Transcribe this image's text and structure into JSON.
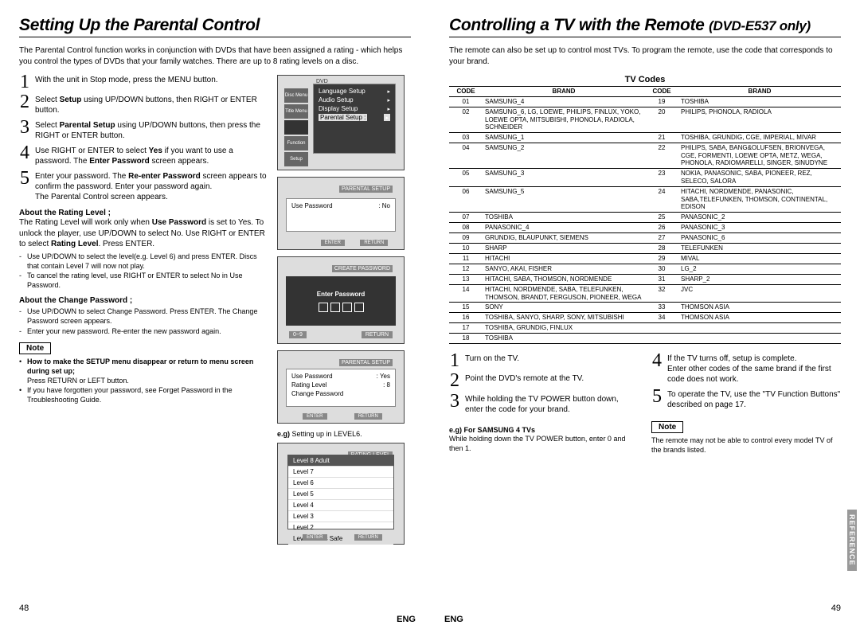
{
  "left": {
    "title": "Setting Up the Parental Control",
    "intro": "The Parental Control function works in conjunction with DVDs that have been assigned a rating - which helps you control the types of DVDs that your family watches. There are up to 8 rating levels on a disc.",
    "steps": [
      "With the unit in Stop mode, press the MENU button.",
      "Select <b>Setup</b> using UP/DOWN buttons, then RIGHT or ENTER button.",
      "Select <b>Parental Setup</b> using UP/DOWN buttons, then press the RIGHT or ENTER button.",
      "Use RIGHT or ENTER to select <b>Yes</b> if you want to use a password. The <b>Enter Password</b> screen appears.",
      "Enter your password. The <b>Re-enter Password</b> screen appears to confirm the password. Enter your password again.<br>The Parental Control screen appears."
    ],
    "about_rating_h": "About the Rating Level ;",
    "about_rating_b": "The Rating Level will work only when <b>Use Password</b> is set to Yes. To unlock the player, use UP/DOWN to select No. Use RIGHT or ENTER to select <b>Rating Level</b>. Press ENTER.",
    "about_rating_bullets": [
      "Use UP/DOWN to select the level(e.g. Level 6) and press ENTER. Discs that contain Level 7 will now not play.",
      "To cancel the rating level, use RIGHT or ENTER to select No in Use Password."
    ],
    "about_pw_h": "About the Change Password ;",
    "about_pw_bullets": [
      "Use UP/DOWN to select Change Password. Press ENTER. The Change Password screen appears.",
      "Enter your new password. Re-enter the new password again."
    ],
    "note_label": "Note",
    "note_b1": "How to make the SETUP menu disappear or return to menu screen during set up;",
    "note_b1s": "Press RETURN or LEFT button.",
    "note_b2": "If you have forgotten your password, see Forget Password in the Troubleshooting Guide.",
    "shot1": {
      "label": "DVD",
      "menu": [
        "Language Setup",
        "Audio Setup",
        "Display Setup"
      ],
      "hl": "Parental Setup :",
      "side": [
        "Disc Menu",
        "Title Menu",
        "",
        "Function",
        "Setup"
      ]
    },
    "shot2": {
      "title": "PARENTAL SETUP",
      "row_l": "Use Password",
      "row_r": ": No",
      "btns": [
        "ENTER",
        "RETURN"
      ]
    },
    "shot3": {
      "title": "CREATE PASSWORD",
      "label": "Enter Password",
      "range": "0~9",
      "btn": "RETURN"
    },
    "shot4": {
      "title": "PARENTAL SETUP",
      "rows": [
        [
          "Use Password",
          ": Yes"
        ],
        [
          "Rating Level",
          ": 8"
        ],
        [
          "Change Password",
          ""
        ]
      ],
      "btns": [
        "ENTER",
        "RETURN"
      ]
    },
    "eg_text": "e.g) Setting up in LEVEL6.",
    "shot5": {
      "title": "RATING LEVEL",
      "levels": [
        "Level 8 Adult",
        "Level 7",
        "Level 6",
        "Level 5",
        "Level 4",
        "Level 3",
        "Level 2",
        "Level 1 Kids Safe"
      ],
      "btns": [
        "ENTER",
        "RETURN"
      ]
    },
    "pagenum": "48",
    "eng": "ENG"
  },
  "right": {
    "title_a": "Controlling a TV with the Remote ",
    "title_b": "(DVD-E537 only)",
    "intro": "The remote can also be set up to control most TVs. To program the remote, use the code that corresponds to your brand.",
    "tvcodes_title": "TV Codes",
    "th_code": "CODE",
    "th_brand": "BRAND",
    "rows_l": [
      [
        "01",
        "SAMSUNG_4"
      ],
      [
        "02",
        "SAMSUNG_6, LG, LOEWE, PHILIPS, FINLUX, YOKO, LOEWE OPTA, MITSUBISHI, PHONOLA, RADIOLA, SCHNEIDER"
      ],
      [
        "03",
        "SAMSUNG_1"
      ],
      [
        "04",
        "SAMSUNG_2"
      ],
      [
        "05",
        "SAMSUNG_3"
      ],
      [
        "06",
        "SAMSUNG_5"
      ],
      [
        "07",
        "TOSHIBA"
      ],
      [
        "08",
        "PANASONIC_4"
      ],
      [
        "09",
        "GRUNDIG, BLAUPUNKT, SIEMENS"
      ],
      [
        "10",
        "SHARP"
      ],
      [
        "11",
        "HITACHI"
      ],
      [
        "12",
        "SANYO, AKAI, FISHER"
      ],
      [
        "13",
        "HITACHI, SABA, THOMSON, NORDMENDE"
      ],
      [
        "14",
        "HITACHI, NORDMENDE, SABA, TELEFUNKEN, THOMSON, BRANDT, FERGUSON, PIONEER, WEGA"
      ],
      [
        "15",
        "SONY"
      ],
      [
        "16",
        "TOSHIBA, SANYO, SHARP, SONY, MITSUBISHI"
      ],
      [
        "17",
        "TOSHIBA, GRUNDIG, FINLUX"
      ],
      [
        "18",
        "TOSHIBA"
      ]
    ],
    "rows_r": [
      [
        "19",
        "TOSHIBA"
      ],
      [
        "20",
        "PHILIPS, PHONOLA, RADIOLA"
      ],
      [
        "21",
        "TOSHIBA, GRUNDIG, CGE, IMPERIAL, MIVAR"
      ],
      [
        "22",
        "PHILIPS, SABA, BANG&OLUFSEN, BRIONVEGA, CGE, FORMENTI, LOEWE OPTA, METZ, WEGA, PHONOLA, RADIOMARELLI, SINGER, SINUDYNE"
      ],
      [
        "23",
        "NOKIA, PANASONIC, SABA, PIONEER, REZ, SELECO, SALORA"
      ],
      [
        "24",
        "HITACHI, NORDMENDE, PANASONIC, SABA,TELEFUNKEN, THOMSON, CONTINENTAL, EDISON"
      ],
      [
        "25",
        "PANASONIC_2"
      ],
      [
        "26",
        "PANASONIC_3"
      ],
      [
        "27",
        "PANASONIC_6"
      ],
      [
        "28",
        "TELEFUNKEN"
      ],
      [
        "29",
        "MIVAL"
      ],
      [
        "30",
        "LG_2"
      ],
      [
        "31",
        "SHARP_2"
      ],
      [
        "32",
        "JVC"
      ],
      [
        "33",
        "THOMSON ASIA"
      ],
      [
        "34",
        "THOMSON ASIA"
      ]
    ],
    "steps_l": [
      "Turn on the TV.",
      "Point the DVD's remote at the TV.",
      "While holding the TV POWER button down, enter the code for your brand."
    ],
    "eg_h": "e.g) For SAMSUNG 4 TVs",
    "eg_b": "While holding down the TV POWER button, enter 0 and then 1.",
    "steps_r": [
      "If the TV turns off, setup is complete.<br>Enter other codes of the same brand if the first code does not work.",
      "To operate the TV, use the \"TV Function Buttons\" described on page 17."
    ],
    "note_label": "Note",
    "note_body": "The remote may not be able to control every model TV of the brands listed.",
    "reference": "REFERENCE",
    "pagenum": "49",
    "eng": "ENG"
  }
}
